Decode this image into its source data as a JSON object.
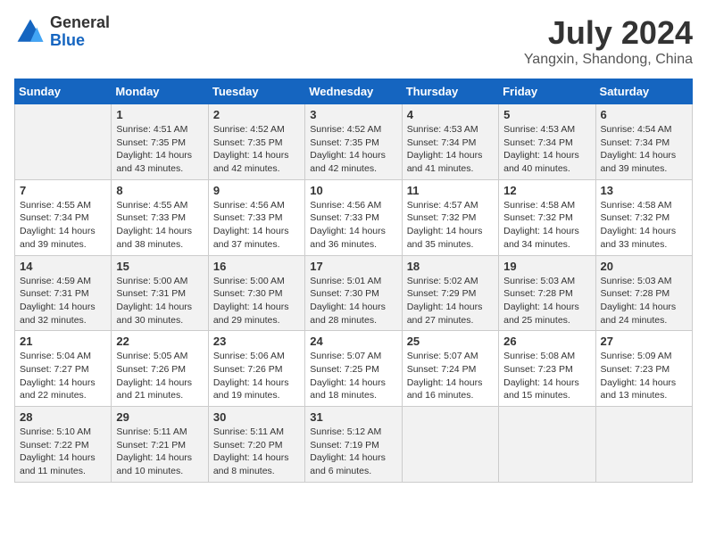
{
  "header": {
    "logo_general": "General",
    "logo_blue": "Blue",
    "title": "July 2024",
    "location": "Yangxin, Shandong, China"
  },
  "days_of_week": [
    "Sunday",
    "Monday",
    "Tuesday",
    "Wednesday",
    "Thursday",
    "Friday",
    "Saturday"
  ],
  "weeks": [
    [
      {
        "day": "",
        "text": ""
      },
      {
        "day": "1",
        "text": "Sunrise: 4:51 AM\nSunset: 7:35 PM\nDaylight: 14 hours\nand 43 minutes."
      },
      {
        "day": "2",
        "text": "Sunrise: 4:52 AM\nSunset: 7:35 PM\nDaylight: 14 hours\nand 42 minutes."
      },
      {
        "day": "3",
        "text": "Sunrise: 4:52 AM\nSunset: 7:35 PM\nDaylight: 14 hours\nand 42 minutes."
      },
      {
        "day": "4",
        "text": "Sunrise: 4:53 AM\nSunset: 7:34 PM\nDaylight: 14 hours\nand 41 minutes."
      },
      {
        "day": "5",
        "text": "Sunrise: 4:53 AM\nSunset: 7:34 PM\nDaylight: 14 hours\nand 40 minutes."
      },
      {
        "day": "6",
        "text": "Sunrise: 4:54 AM\nSunset: 7:34 PM\nDaylight: 14 hours\nand 39 minutes."
      }
    ],
    [
      {
        "day": "7",
        "text": "Sunrise: 4:55 AM\nSunset: 7:34 PM\nDaylight: 14 hours\nand 39 minutes."
      },
      {
        "day": "8",
        "text": "Sunrise: 4:55 AM\nSunset: 7:33 PM\nDaylight: 14 hours\nand 38 minutes."
      },
      {
        "day": "9",
        "text": "Sunrise: 4:56 AM\nSunset: 7:33 PM\nDaylight: 14 hours\nand 37 minutes."
      },
      {
        "day": "10",
        "text": "Sunrise: 4:56 AM\nSunset: 7:33 PM\nDaylight: 14 hours\nand 36 minutes."
      },
      {
        "day": "11",
        "text": "Sunrise: 4:57 AM\nSunset: 7:32 PM\nDaylight: 14 hours\nand 35 minutes."
      },
      {
        "day": "12",
        "text": "Sunrise: 4:58 AM\nSunset: 7:32 PM\nDaylight: 14 hours\nand 34 minutes."
      },
      {
        "day": "13",
        "text": "Sunrise: 4:58 AM\nSunset: 7:32 PM\nDaylight: 14 hours\nand 33 minutes."
      }
    ],
    [
      {
        "day": "14",
        "text": "Sunrise: 4:59 AM\nSunset: 7:31 PM\nDaylight: 14 hours\nand 32 minutes."
      },
      {
        "day": "15",
        "text": "Sunrise: 5:00 AM\nSunset: 7:31 PM\nDaylight: 14 hours\nand 30 minutes."
      },
      {
        "day": "16",
        "text": "Sunrise: 5:00 AM\nSunset: 7:30 PM\nDaylight: 14 hours\nand 29 minutes."
      },
      {
        "day": "17",
        "text": "Sunrise: 5:01 AM\nSunset: 7:30 PM\nDaylight: 14 hours\nand 28 minutes."
      },
      {
        "day": "18",
        "text": "Sunrise: 5:02 AM\nSunset: 7:29 PM\nDaylight: 14 hours\nand 27 minutes."
      },
      {
        "day": "19",
        "text": "Sunrise: 5:03 AM\nSunset: 7:28 PM\nDaylight: 14 hours\nand 25 minutes."
      },
      {
        "day": "20",
        "text": "Sunrise: 5:03 AM\nSunset: 7:28 PM\nDaylight: 14 hours\nand 24 minutes."
      }
    ],
    [
      {
        "day": "21",
        "text": "Sunrise: 5:04 AM\nSunset: 7:27 PM\nDaylight: 14 hours\nand 22 minutes."
      },
      {
        "day": "22",
        "text": "Sunrise: 5:05 AM\nSunset: 7:26 PM\nDaylight: 14 hours\nand 21 minutes."
      },
      {
        "day": "23",
        "text": "Sunrise: 5:06 AM\nSunset: 7:26 PM\nDaylight: 14 hours\nand 19 minutes."
      },
      {
        "day": "24",
        "text": "Sunrise: 5:07 AM\nSunset: 7:25 PM\nDaylight: 14 hours\nand 18 minutes."
      },
      {
        "day": "25",
        "text": "Sunrise: 5:07 AM\nSunset: 7:24 PM\nDaylight: 14 hours\nand 16 minutes."
      },
      {
        "day": "26",
        "text": "Sunrise: 5:08 AM\nSunset: 7:23 PM\nDaylight: 14 hours\nand 15 minutes."
      },
      {
        "day": "27",
        "text": "Sunrise: 5:09 AM\nSunset: 7:23 PM\nDaylight: 14 hours\nand 13 minutes."
      }
    ],
    [
      {
        "day": "28",
        "text": "Sunrise: 5:10 AM\nSunset: 7:22 PM\nDaylight: 14 hours\nand 11 minutes."
      },
      {
        "day": "29",
        "text": "Sunrise: 5:11 AM\nSunset: 7:21 PM\nDaylight: 14 hours\nand 10 minutes."
      },
      {
        "day": "30",
        "text": "Sunrise: 5:11 AM\nSunset: 7:20 PM\nDaylight: 14 hours\nand 8 minutes."
      },
      {
        "day": "31",
        "text": "Sunrise: 5:12 AM\nSunset: 7:19 PM\nDaylight: 14 hours\nand 6 minutes."
      },
      {
        "day": "",
        "text": ""
      },
      {
        "day": "",
        "text": ""
      },
      {
        "day": "",
        "text": ""
      }
    ]
  ]
}
